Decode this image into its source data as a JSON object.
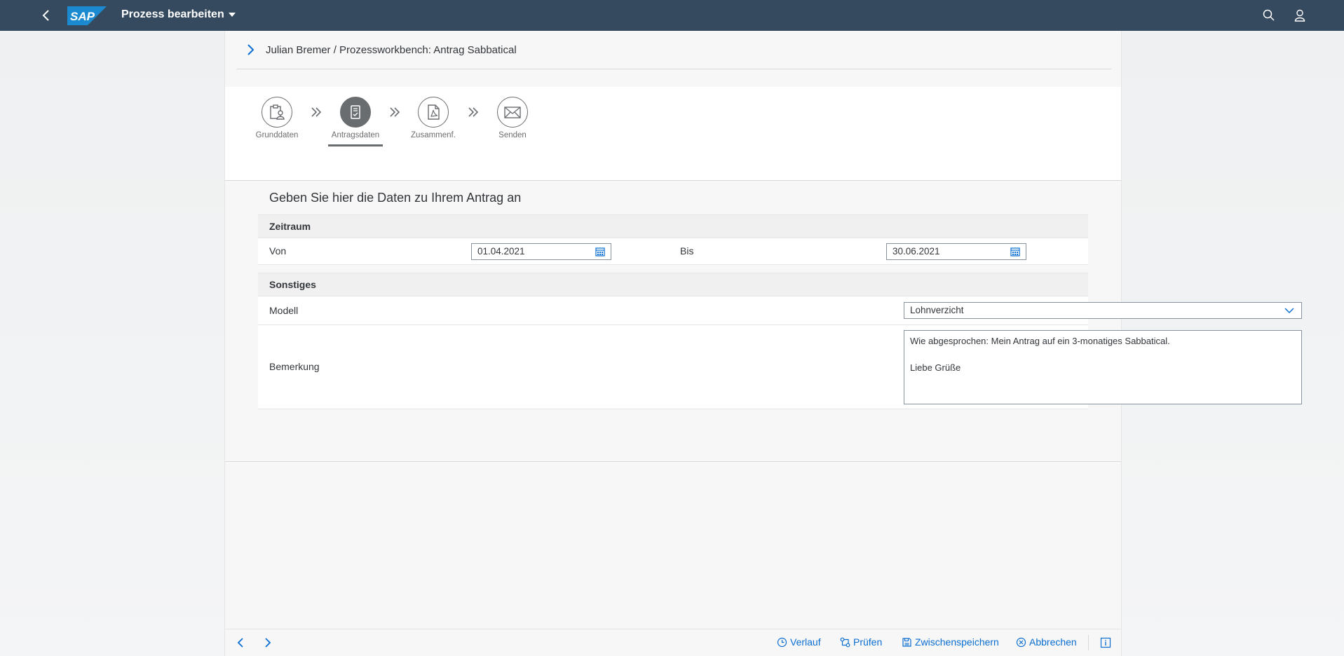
{
  "shell": {
    "title": "Prozess bearbeiten",
    "logo_text": "SAP",
    "icons": [
      "back-icon",
      "search-icon",
      "user-icon",
      "caret-down-icon"
    ]
  },
  "breadcrumb": {
    "text": "Julian Bremer / Prozessworkbench: Antrag Sabbatical"
  },
  "wizard": {
    "steps": [
      {
        "label": "Grunddaten",
        "icon": "clipboard-user-icon",
        "active": false
      },
      {
        "label": "Antragsdaten",
        "icon": "document-check-icon",
        "active": true
      },
      {
        "label": "Zusammenf.",
        "icon": "pdf-document-icon",
        "active": false
      },
      {
        "label": "Senden",
        "icon": "envelope-icon",
        "active": false
      }
    ]
  },
  "form": {
    "title": "Geben Sie hier die Daten zu Ihrem Antrag an",
    "groups": {
      "zeitraum": {
        "title": "Zeitraum",
        "von_label": "Von",
        "von_value": "01.04.2021",
        "bis_label": "Bis",
        "bis_value": "30.06.2021"
      },
      "sonstiges": {
        "title": "Sonstiges",
        "modell_label": "Modell",
        "modell_value": "Lohnverzicht",
        "bemerkung_label": "Bemerkung",
        "bemerkung_value": "Wie abgesprochen: Mein Antrag auf ein 3-monatiges Sabbatical.\n\nLiebe Grüße"
      }
    }
  },
  "footer": {
    "verlauf": "Verlauf",
    "pruefen": "Prüfen",
    "zwischenspeichern": "Zwischenspeichern",
    "abbrechen": "Abbrechen"
  },
  "colors": {
    "shell": "#354a5f",
    "accent": "#0a6ed1",
    "step_active": "#6a6d70"
  }
}
